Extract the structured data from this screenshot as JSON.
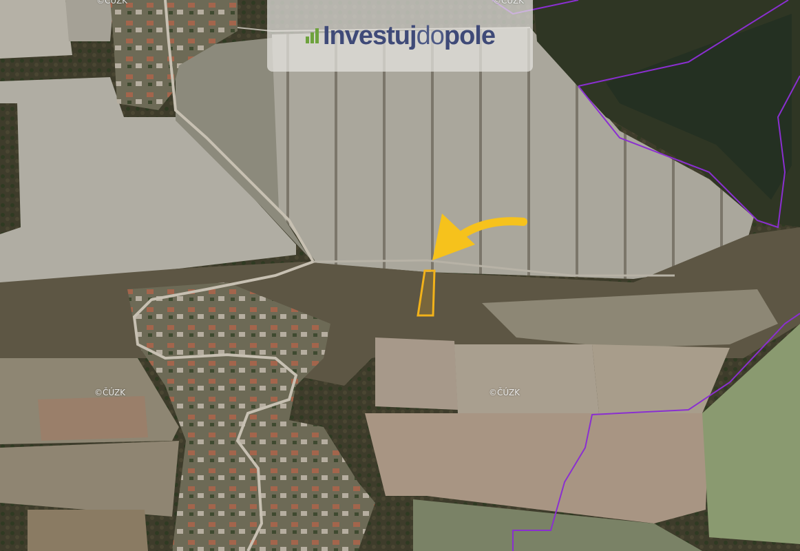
{
  "logo": {
    "part1": "Investuj",
    "part2": "do",
    "part3": "pole",
    "icon": "bar-chart-icon"
  },
  "watermark": {
    "text": "©ČÚZK"
  },
  "colors": {
    "boundary": "#8a2fd0",
    "parcel": "#f2b21a",
    "arrow": "#f6c21c",
    "logo_text": "#3f4a78"
  },
  "map": {
    "type": "aerial orthophoto",
    "highlighted_parcel": true,
    "arrow_to_parcel": true
  }
}
